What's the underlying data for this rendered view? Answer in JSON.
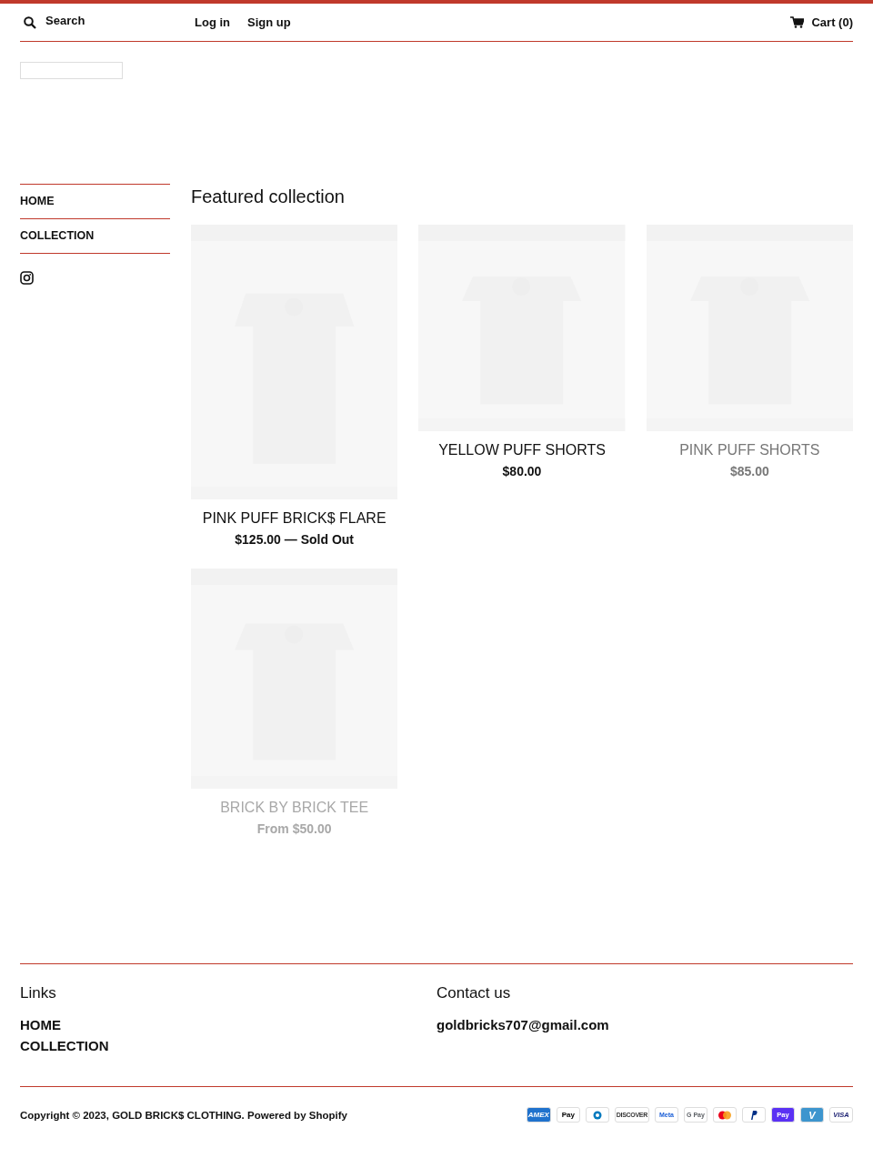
{
  "header": {
    "search": {
      "placeholder": "Search"
    },
    "links": [
      "Log in",
      "Sign up"
    ],
    "cart": "Cart (0)"
  },
  "sidebar": {
    "items": [
      "HOME",
      "COLLECTION"
    ]
  },
  "main": {
    "title": "Featured collection",
    "products": [
      {
        "name": "PINK PUFF BRICK$ FLARE",
        "price": "$125.00 — Sold Out",
        "kind": "tall",
        "color": "#111111"
      },
      {
        "name": "YELLOW PUFF SHORTS",
        "price": "$80.00",
        "kind": "square",
        "color": "#111111"
      },
      {
        "name": "PINK PUFF SHORTS",
        "price": "$85.00",
        "kind": "square",
        "color": "#777777"
      },
      {
        "name": "BRICK BY BRICK TEE",
        "price": "From $50.00",
        "kind": "portrait",
        "color": "#a8a8a8"
      }
    ]
  },
  "footer": {
    "links_title": "Links",
    "links": [
      "HOME",
      "COLLECTION"
    ],
    "contact_title": "Contact us",
    "email": "goldbricks707@gmail.com",
    "copyright": "Copyright © 2023, GOLD BRICK$ CLOTHING. Powered by Shopify",
    "payments": [
      {
        "kind": "amex",
        "label": "AMEX"
      },
      {
        "kind": "apple",
        "label": "Pay"
      },
      {
        "kind": "diners"
      },
      {
        "kind": "discover",
        "label": "DISCOVER"
      },
      {
        "kind": "meta",
        "label": "Meta"
      },
      {
        "kind": "gpay",
        "label": "G Pay"
      },
      {
        "kind": "mastercard"
      },
      {
        "kind": "paypal"
      },
      {
        "kind": "shop",
        "label": "Pay"
      },
      {
        "kind": "venmo",
        "label": "V"
      },
      {
        "kind": "visa",
        "label": "VISA"
      }
    ]
  }
}
